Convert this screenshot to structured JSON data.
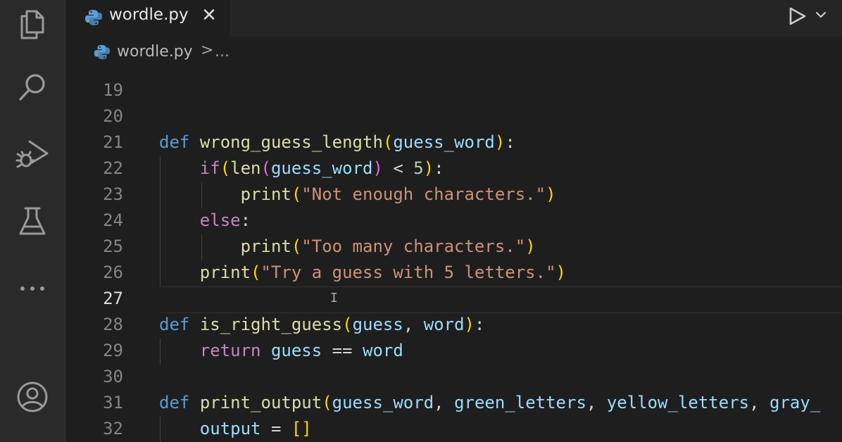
{
  "tab": {
    "title": "wordle.py",
    "close_glyph": "✕"
  },
  "breadcrumb": {
    "file": "wordle.py",
    "separator": ">",
    "more": "..."
  },
  "editor": {
    "active_line": 27,
    "lines": [
      {
        "num": "19",
        "tokens": []
      },
      {
        "num": "20",
        "tokens": []
      },
      {
        "num": "21",
        "tokens": [
          {
            "t": "def",
            "c": "kw"
          },
          {
            "t": " ",
            "c": "punc"
          },
          {
            "t": "wrong_guess_length",
            "c": "fn"
          },
          {
            "t": "(",
            "c": "brk"
          },
          {
            "t": "guess_word",
            "c": "param"
          },
          {
            "t": ")",
            "c": "brk"
          },
          {
            "t": ":",
            "c": "punc"
          }
        ]
      },
      {
        "num": "22",
        "tokens": [
          {
            "t": "    ",
            "c": "punc"
          },
          {
            "t": "if",
            "c": "ctrl"
          },
          {
            "t": "(",
            "c": "brk"
          },
          {
            "t": "len",
            "c": "fn"
          },
          {
            "t": "(",
            "c": "brk2"
          },
          {
            "t": "guess_word",
            "c": "param"
          },
          {
            "t": ")",
            "c": "brk2"
          },
          {
            "t": " < ",
            "c": "punc"
          },
          {
            "t": "5",
            "c": "num"
          },
          {
            "t": ")",
            "c": "brk"
          },
          {
            "t": ":",
            "c": "punc"
          }
        ]
      },
      {
        "num": "23",
        "tokens": [
          {
            "t": "        ",
            "c": "punc"
          },
          {
            "t": "print",
            "c": "fn"
          },
          {
            "t": "(",
            "c": "brk"
          },
          {
            "t": "\"Not enough characters.\"",
            "c": "str"
          },
          {
            "t": ")",
            "c": "brk"
          }
        ]
      },
      {
        "num": "24",
        "tokens": [
          {
            "t": "    ",
            "c": "punc"
          },
          {
            "t": "else",
            "c": "ctrl"
          },
          {
            "t": ":",
            "c": "punc"
          }
        ]
      },
      {
        "num": "25",
        "tokens": [
          {
            "t": "        ",
            "c": "punc"
          },
          {
            "t": "print",
            "c": "fn"
          },
          {
            "t": "(",
            "c": "brk"
          },
          {
            "t": "\"Too many characters.\"",
            "c": "str"
          },
          {
            "t": ")",
            "c": "brk"
          }
        ]
      },
      {
        "num": "26",
        "tokens": [
          {
            "t": "    ",
            "c": "punc"
          },
          {
            "t": "print",
            "c": "fn"
          },
          {
            "t": "(",
            "c": "brk"
          },
          {
            "t": "\"Try a guess with 5 letters.\"",
            "c": "str"
          },
          {
            "t": ")",
            "c": "brk"
          }
        ]
      },
      {
        "num": "27",
        "tokens": []
      },
      {
        "num": "28",
        "tokens": [
          {
            "t": "def",
            "c": "kw"
          },
          {
            "t": " ",
            "c": "punc"
          },
          {
            "t": "is_right_guess",
            "c": "fn"
          },
          {
            "t": "(",
            "c": "brk"
          },
          {
            "t": "guess",
            "c": "param"
          },
          {
            "t": ", ",
            "c": "punc"
          },
          {
            "t": "word",
            "c": "param"
          },
          {
            "t": ")",
            "c": "brk"
          },
          {
            "t": ":",
            "c": "punc"
          }
        ]
      },
      {
        "num": "29",
        "tokens": [
          {
            "t": "    ",
            "c": "punc"
          },
          {
            "t": "return",
            "c": "ctrl"
          },
          {
            "t": " ",
            "c": "punc"
          },
          {
            "t": "guess",
            "c": "param"
          },
          {
            "t": " == ",
            "c": "punc"
          },
          {
            "t": "word",
            "c": "param"
          }
        ]
      },
      {
        "num": "30",
        "tokens": []
      },
      {
        "num": "31",
        "tokens": [
          {
            "t": "def",
            "c": "kw"
          },
          {
            "t": " ",
            "c": "punc"
          },
          {
            "t": "print_output",
            "c": "fn"
          },
          {
            "t": "(",
            "c": "brk"
          },
          {
            "t": "guess_word",
            "c": "param"
          },
          {
            "t": ", ",
            "c": "punc"
          },
          {
            "t": "green_letters",
            "c": "param"
          },
          {
            "t": ", ",
            "c": "punc"
          },
          {
            "t": "yellow_letters",
            "c": "param"
          },
          {
            "t": ", ",
            "c": "punc"
          },
          {
            "t": "gray_",
            "c": "param"
          }
        ]
      },
      {
        "num": "32",
        "tokens": [
          {
            "t": "    ",
            "c": "punc"
          },
          {
            "t": "output",
            "c": "param"
          },
          {
            "t": " = ",
            "c": "punc"
          },
          {
            "t": "[]",
            "c": "brk"
          }
        ]
      }
    ]
  },
  "icons": {
    "explorer": "files-icon",
    "search": "search-icon",
    "debug": "run-debug-icon",
    "testing": "flask-icon",
    "more": "more-icon",
    "account": "account-icon",
    "run": "play-icon",
    "run_menu": "chevron-down-icon",
    "python": "python-icon"
  },
  "colors": {
    "keyword": "#569cd6",
    "control": "#c586c0",
    "function": "#dcdcaa",
    "variable": "#9cdcfe",
    "string": "#ce9178",
    "number": "#b5cea8",
    "bracket": "#ffd700"
  }
}
